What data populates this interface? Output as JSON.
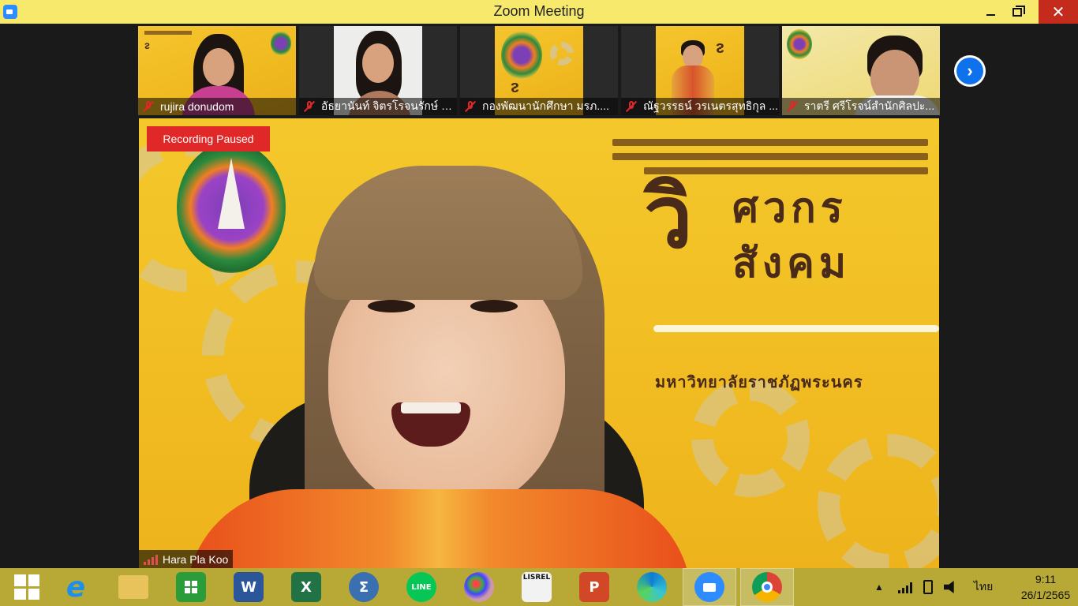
{
  "window": {
    "title": "Zoom Meeting",
    "minimize_glyph": "—",
    "close_glyph": "✕"
  },
  "gallery": {
    "participants": [
      {
        "name": "rujira donudom",
        "mic": "muted"
      },
      {
        "name": "อัธยานันท์ จิตรโรจนรักษ์ ค...",
        "mic": "muted"
      },
      {
        "name": "กองพัฒนานักศึกษา มรภ....",
        "mic": "muted"
      },
      {
        "name": "ณัฐวรรธน์ วรเนตรสุทธิกุล ...",
        "mic": "muted"
      },
      {
        "name": "ราตรี   ศรีโรจน์สำนักศิลปะ...",
        "mic": "muted"
      }
    ],
    "next_glyph": "›"
  },
  "speaker": {
    "name": "Hara Pla Koo",
    "recording_status": "Recording Paused",
    "background": {
      "title_big_letter": "วิ",
      "title_line1": "ศวกร",
      "title_line2": "สังคม",
      "subtitle": "มหาวิทยาลัยราชภัฏพระนคร"
    }
  },
  "taskbar": {
    "apps": [
      {
        "name": "start",
        "icon": "windows-logo-icon"
      },
      {
        "name": "internet-explorer",
        "icon": "ie-icon",
        "label": "e",
        "color": "#1e90e8"
      },
      {
        "name": "file-explorer",
        "icon": "folder-icon",
        "color": "#e8c25a"
      },
      {
        "name": "store",
        "icon": "store-icon",
        "color": "#2a9d3a"
      },
      {
        "name": "word",
        "icon": "word-icon",
        "label": "W",
        "color": "#2b579a"
      },
      {
        "name": "excel",
        "icon": "excel-icon",
        "label": "X",
        "color": "#217346"
      },
      {
        "name": "math-input",
        "icon": "math-icon",
        "label": "Σ",
        "color": "#3a6fb0"
      },
      {
        "name": "line",
        "icon": "line-icon",
        "label": "LINE",
        "color": "#06c755"
      },
      {
        "name": "paint",
        "icon": "paint-icon",
        "color": "#8ab4f8"
      },
      {
        "name": "lisrel",
        "icon": "lisrel-icon",
        "label": "LISREL",
        "color": "#f2f2f2"
      },
      {
        "name": "powerpoint",
        "icon": "powerpoint-icon",
        "label": "P",
        "color": "#d24726"
      },
      {
        "name": "edge",
        "icon": "edge-icon",
        "color": "#0c7bd6"
      },
      {
        "name": "zoom",
        "icon": "zoom-icon",
        "color": "#2d8cff"
      },
      {
        "name": "chrome",
        "icon": "chrome-icon",
        "color": "#db4437"
      }
    ],
    "language": "ไทย",
    "time": "9:11",
    "date": "26/1/2565"
  }
}
